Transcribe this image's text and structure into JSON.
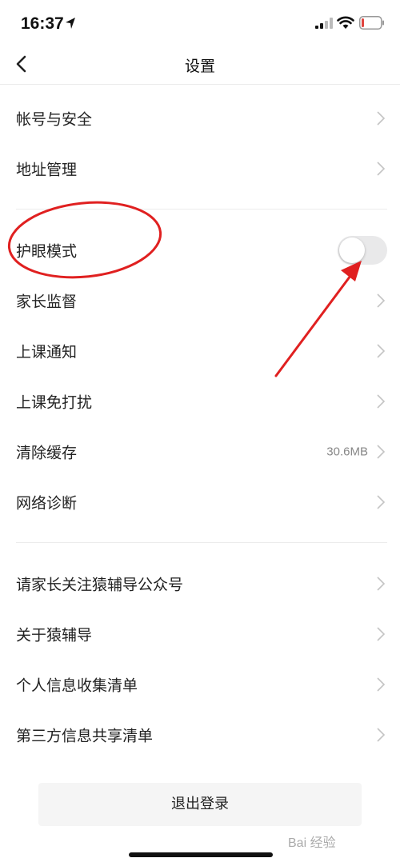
{
  "status_bar": {
    "time": "16:37",
    "icons": [
      "location-arrow-icon",
      "signal-icon",
      "wifi-icon",
      "battery-icon"
    ],
    "battery_color": "#e0443e"
  },
  "nav": {
    "title": "设置",
    "back_icon": "chevron-left-icon"
  },
  "groups": [
    {
      "items": [
        {
          "label": "帐号与安全",
          "type": "link"
        },
        {
          "label": "地址管理",
          "type": "link"
        }
      ]
    },
    {
      "items": [
        {
          "label": "护眼模式",
          "type": "toggle",
          "enabled": false
        },
        {
          "label": "家长监督",
          "type": "link"
        },
        {
          "label": "上课通知",
          "type": "link"
        },
        {
          "label": "上课免打扰",
          "type": "link"
        },
        {
          "label": "清除缓存",
          "type": "link",
          "value": "30.6MB"
        },
        {
          "label": "网络诊断",
          "type": "link"
        }
      ]
    },
    {
      "items": [
        {
          "label": "请家长关注猿辅导公众号",
          "type": "link"
        },
        {
          "label": "关于猿辅导",
          "type": "link"
        },
        {
          "label": "个人信息收集清单",
          "type": "link"
        },
        {
          "label": "第三方信息共享清单",
          "type": "link"
        }
      ]
    }
  ],
  "logout_label": "退出登录",
  "annotation_color": "#e02020",
  "watermark": "Bai 经验"
}
